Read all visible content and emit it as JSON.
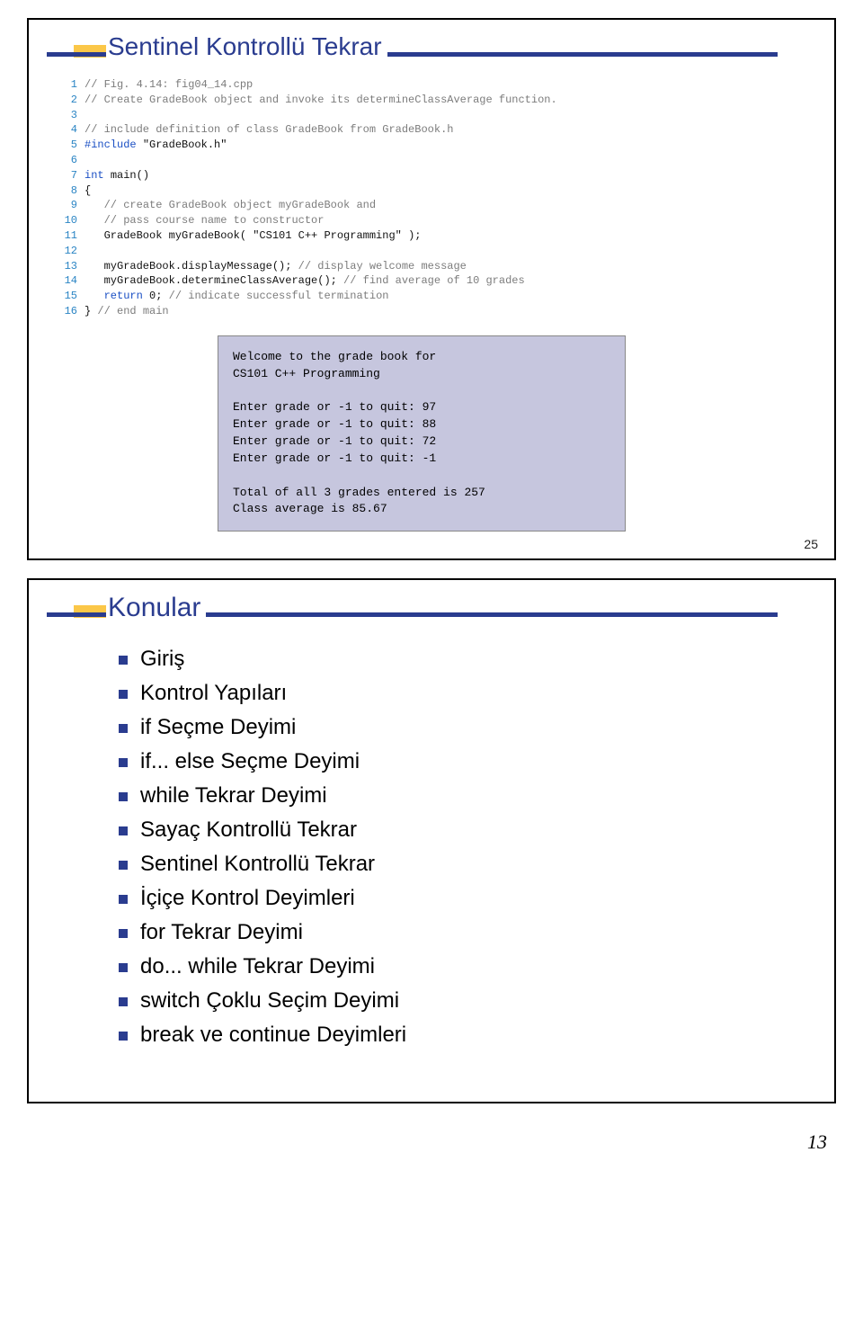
{
  "slide1": {
    "title": "Sentinel Kontrollü Tekrar",
    "page_number": "25",
    "code": [
      {
        "n": "1",
        "segs": [
          {
            "c": "gray",
            "t": "// Fig. 4.14: fig04_14.cpp"
          }
        ]
      },
      {
        "n": "2",
        "segs": [
          {
            "c": "gray",
            "t": "// Create GradeBook object and invoke its determineClassAverage function."
          }
        ]
      },
      {
        "n": "3",
        "segs": []
      },
      {
        "n": "4",
        "segs": [
          {
            "c": "gray",
            "t": "// include definition of class GradeBook from GradeBook.h"
          }
        ]
      },
      {
        "n": "5",
        "segs": [
          {
            "c": "blue",
            "t": "#include "
          },
          {
            "c": "black",
            "t": "\"GradeBook.h\""
          }
        ]
      },
      {
        "n": "6",
        "segs": []
      },
      {
        "n": "7",
        "segs": [
          {
            "c": "blue",
            "t": "int "
          },
          {
            "c": "black",
            "t": "main()"
          }
        ]
      },
      {
        "n": "8",
        "segs": [
          {
            "c": "black",
            "t": "{"
          }
        ]
      },
      {
        "n": "9",
        "segs": [
          {
            "c": "black",
            "t": "   "
          },
          {
            "c": "gray",
            "t": "// create GradeBook object myGradeBook and"
          }
        ]
      },
      {
        "n": "10",
        "segs": [
          {
            "c": "black",
            "t": "   "
          },
          {
            "c": "gray",
            "t": "// pass course name to constructor"
          }
        ]
      },
      {
        "n": "11",
        "segs": [
          {
            "c": "black",
            "t": "   GradeBook myGradeBook( "
          },
          {
            "c": "black",
            "t": "\"CS101 C++ Programming\""
          },
          {
            "c": "black",
            "t": " );"
          }
        ]
      },
      {
        "n": "12",
        "segs": []
      },
      {
        "n": "13",
        "segs": [
          {
            "c": "black",
            "t": "   myGradeBook.displayMessage(); "
          },
          {
            "c": "gray",
            "t": "// display welcome message"
          }
        ]
      },
      {
        "n": "14",
        "segs": [
          {
            "c": "black",
            "t": "   myGradeBook.determineClassAverage(); "
          },
          {
            "c": "gray",
            "t": "// find average of 10 grades"
          }
        ]
      },
      {
        "n": "15",
        "segs": [
          {
            "c": "black",
            "t": "   "
          },
          {
            "c": "blue",
            "t": "return "
          },
          {
            "c": "black",
            "t": "0; "
          },
          {
            "c": "gray",
            "t": "// indicate successful termination"
          }
        ]
      },
      {
        "n": "16",
        "segs": [
          {
            "c": "black",
            "t": "} "
          },
          {
            "c": "gray",
            "t": "// end main"
          }
        ]
      }
    ],
    "output": "Welcome to the grade book for\nCS101 C++ Programming\n\nEnter grade or -1 to quit: 97\nEnter grade or -1 to quit: 88\nEnter grade or -1 to quit: 72\nEnter grade or -1 to quit: -1\n\nTotal of all 3 grades entered is 257\nClass average is 85.67"
  },
  "slide2": {
    "title": "Konular",
    "bullets": [
      "Giriş",
      "Kontrol Yapıları",
      "if Seçme Deyimi",
      "if... else Seçme Deyimi",
      "while Tekrar Deyimi",
      "Sayaç Kontrollü Tekrar",
      "Sentinel Kontrollü Tekrar",
      "İçiçe Kontrol Deyimleri",
      "for Tekrar Deyimi",
      "do... while Tekrar Deyimi",
      "switch Çoklu Seçim Deyimi",
      "break ve continue Deyimleri"
    ]
  },
  "page_footer": "13"
}
